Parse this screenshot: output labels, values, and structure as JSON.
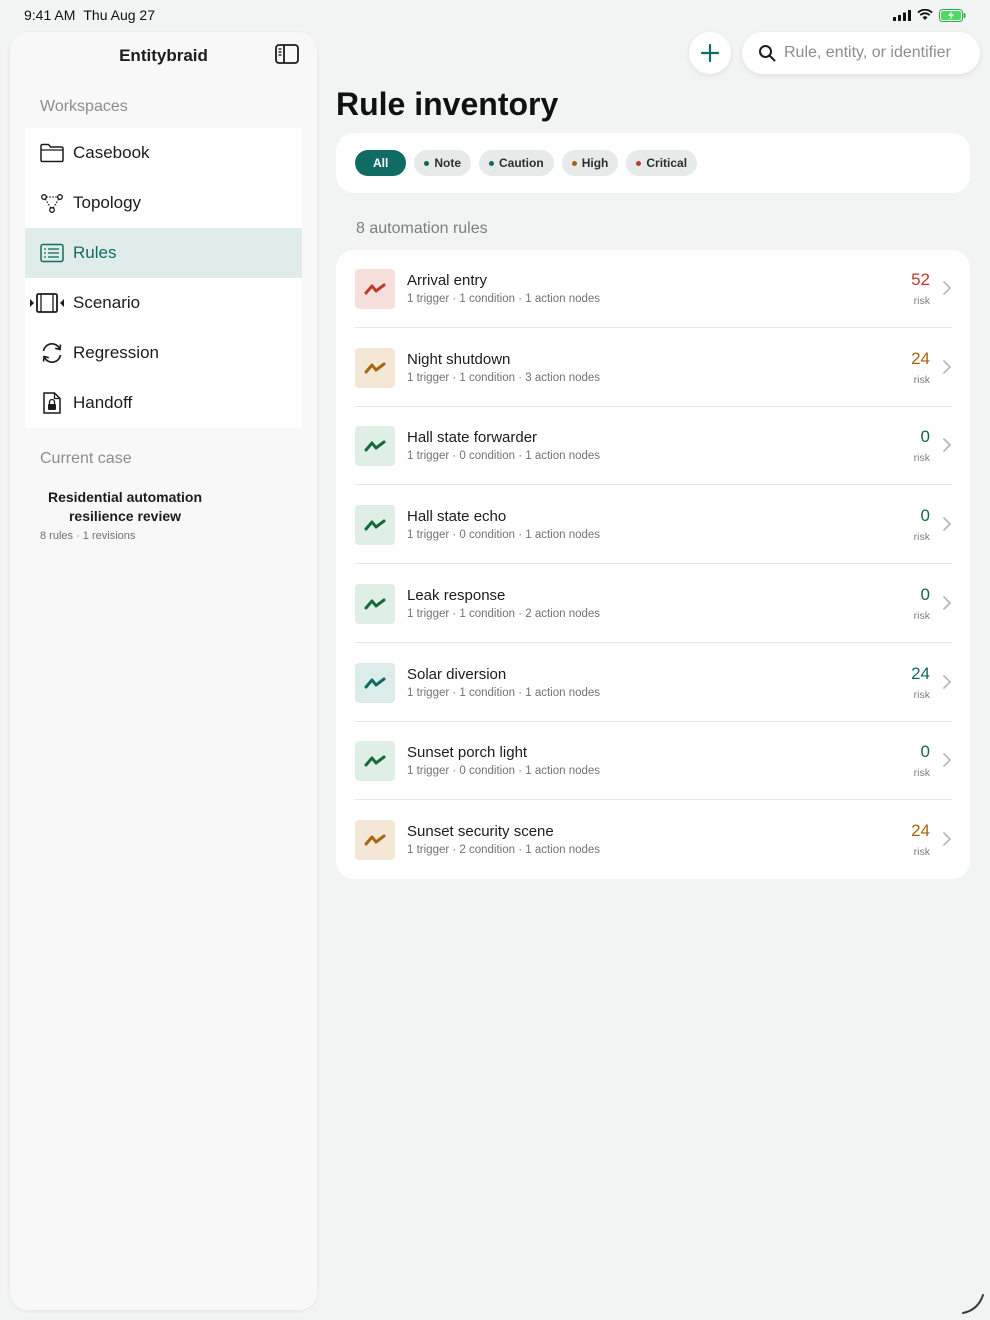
{
  "status_bar": {
    "time": "9:41 AM",
    "date": "Thu Aug 27"
  },
  "sidebar": {
    "app_title": "Entitybraid",
    "workspaces_label": "Workspaces",
    "items": [
      {
        "label": "Casebook",
        "icon": "folder-icon"
      },
      {
        "label": "Topology",
        "icon": "topology-icon"
      },
      {
        "label": "Rules",
        "icon": "list-icon",
        "active": true
      },
      {
        "label": "Scenario",
        "icon": "film-icon"
      },
      {
        "label": "Regression",
        "icon": "refresh-icon"
      },
      {
        "label": "Handoff",
        "icon": "locked-document-icon"
      }
    ],
    "current_case_label": "Current case",
    "current_case_title": "Residential automation resilience review",
    "current_case_meta": "8 rules · 1 revisions"
  },
  "search": {
    "placeholder": "Rule, entity, or identifier",
    "value": ""
  },
  "main": {
    "title": "Rule inventory",
    "filters": [
      {
        "label": "All",
        "active": true
      },
      {
        "label": "Note",
        "dot_color": "#146b3a"
      },
      {
        "label": "Caution",
        "dot_color": "#0f6b63"
      },
      {
        "label": "High",
        "dot_color": "#a8650f"
      },
      {
        "label": "Critical",
        "dot_color": "#c0392b"
      }
    ],
    "rule_count": "8 automation rules",
    "risk_label": "risk",
    "rules": [
      {
        "name": "Arrival entry",
        "meta": "1 trigger · 1 condition · 1 action nodes",
        "risk": "52",
        "severity": "critical"
      },
      {
        "name": "Night shutdown",
        "meta": "1 trigger · 1 condition · 3 action nodes",
        "risk": "24",
        "severity": "high"
      },
      {
        "name": "Hall state forwarder",
        "meta": "1 trigger · 0 condition · 1 action nodes",
        "risk": "0",
        "severity": "note"
      },
      {
        "name": "Hall state echo",
        "meta": "1 trigger · 0 condition · 1 action nodes",
        "risk": "0",
        "severity": "note"
      },
      {
        "name": "Leak response",
        "meta": "1 trigger · 1 condition · 2 action nodes",
        "risk": "0",
        "severity": "note"
      },
      {
        "name": "Solar diversion",
        "meta": "1 trigger · 1 condition · 1 action nodes",
        "risk": "24",
        "severity": "caution"
      },
      {
        "name": "Sunset porch light",
        "meta": "1 trigger · 0 condition · 1 action nodes",
        "risk": "0",
        "severity": "note"
      },
      {
        "name": "Sunset security scene",
        "meta": "1 trigger · 2 condition · 1 action nodes",
        "risk": "24",
        "severity": "high"
      }
    ]
  },
  "colors": {
    "accent": "#0f6b63",
    "critical": "#c0392b",
    "high": "#a8650f",
    "caution": "#0f6b63",
    "note": "#146b3a"
  }
}
